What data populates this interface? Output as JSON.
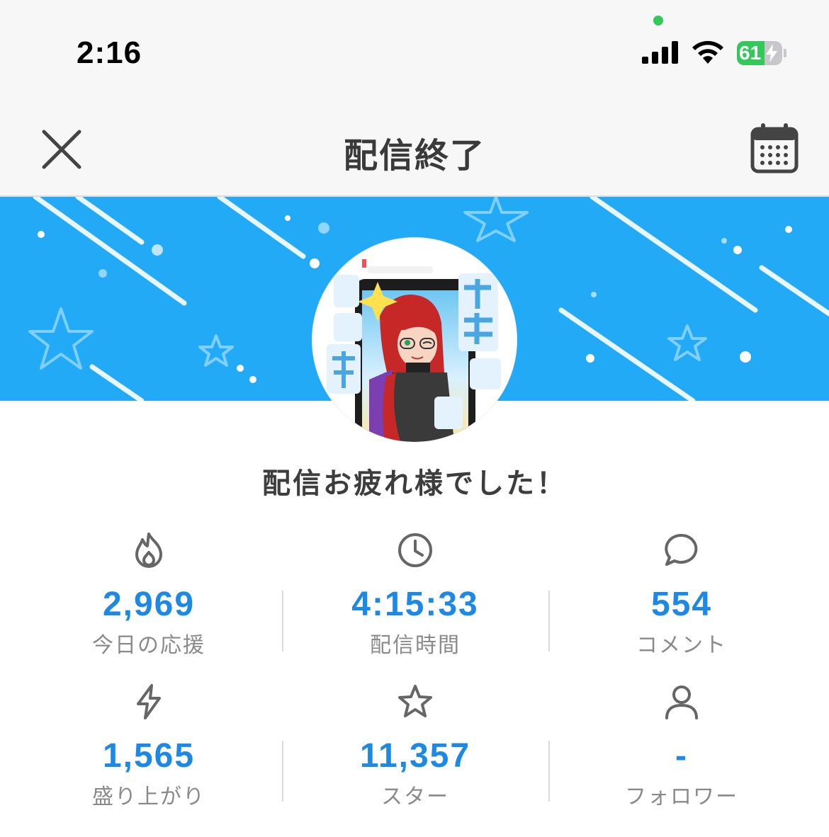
{
  "status_bar": {
    "time": "2:16",
    "battery_level": "61",
    "battery_fraction": 0.61,
    "icons": [
      "cellular-signal-icon",
      "wifi-icon",
      "battery-charging-icon"
    ]
  },
  "nav": {
    "title": "配信終了",
    "left_icon": "close-icon",
    "right_icon": "calendar-icon"
  },
  "colors": {
    "banner": "#22aaf7",
    "accent_value": "#1e88e5",
    "label": "#8a8a8a",
    "title": "#3a3a3a"
  },
  "message": "配信お疲れ様でした！",
  "stats": [
    {
      "icon": "flame-icon",
      "value": "2,969",
      "label": "今日の応援"
    },
    {
      "icon": "clock-icon",
      "value": "4:15:33",
      "label": "配信時間"
    },
    {
      "icon": "comment-icon",
      "value": "554",
      "label": "コメント"
    },
    {
      "icon": "lightning-icon",
      "value": "1,565",
      "label": "盛り上がり"
    },
    {
      "icon": "star-icon",
      "value": "11,357",
      "label": "スター"
    },
    {
      "icon": "person-icon",
      "value": "-",
      "label": "フォロワー"
    }
  ]
}
